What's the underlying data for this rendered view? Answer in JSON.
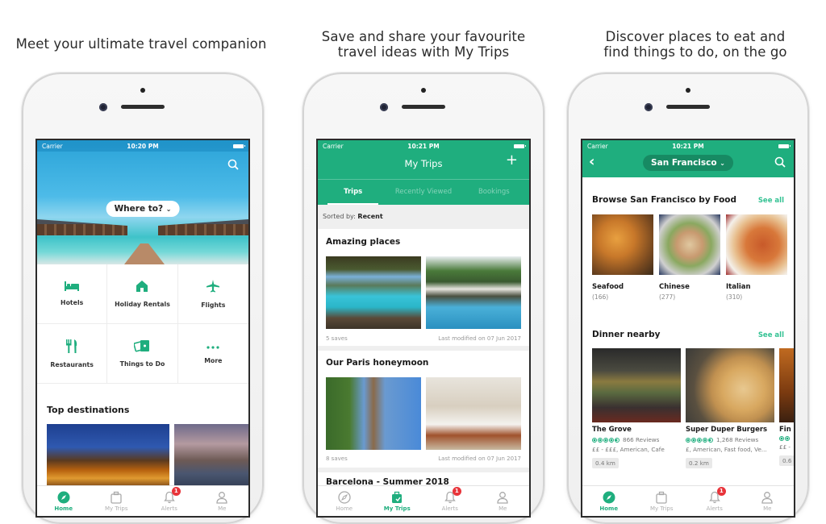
{
  "colors": {
    "accent": "#1fae7e",
    "accent_dark": "#178a63",
    "badge": "#e8343a",
    "hero_sky": "#2aa3d8"
  },
  "panels": [
    {
      "caption_lines": [
        "Meet your ultimate travel companion"
      ],
      "status": {
        "carrier": "Carrier",
        "time": "10:20 PM"
      },
      "search_icon": "search-icon",
      "where_to": "Where to?",
      "categories": [
        {
          "label": "Hotels",
          "icon": "bed-icon"
        },
        {
          "label": "Holiday Rentals",
          "icon": "house-icon"
        },
        {
          "label": "Flights",
          "icon": "plane-icon"
        },
        {
          "label": "Restaurants",
          "icon": "fork-knife-icon"
        },
        {
          "label": "Things to Do",
          "icon": "ticket-icon"
        },
        {
          "label": "More",
          "icon": "more-dots-icon"
        }
      ],
      "section_title": "Top destinations",
      "tabs": [
        {
          "label": "Home",
          "icon": "compass-icon",
          "active": true
        },
        {
          "label": "My Trips",
          "icon": "suitcase-icon",
          "active": false
        },
        {
          "label": "Alerts",
          "icon": "bell-icon",
          "active": false,
          "badge": "1"
        },
        {
          "label": "Me",
          "icon": "person-icon",
          "active": false
        }
      ]
    },
    {
      "caption_lines": [
        "Save and share your favourite",
        "travel ideas with My Trips"
      ],
      "status": {
        "carrier": "Carrier",
        "time": "10:21 PM"
      },
      "title": "My Trips",
      "add_label": "+",
      "subtabs": [
        {
          "label": "Trips",
          "active": true
        },
        {
          "label": "Recently Viewed",
          "active": false
        },
        {
          "label": "Bookings",
          "active": false
        }
      ],
      "sort_prefix": "Sorted by:",
      "sort_value": "Recent",
      "trips": [
        {
          "name": "Amazing places",
          "saves": "5 saves",
          "modified": "Last modified on 07 Jun 2017"
        },
        {
          "name": "Our Paris honeymoon",
          "saves": "8 saves",
          "modified": "Last modified on 07 Jun 2017"
        },
        {
          "name": "Barcelona - Summer 2018"
        }
      ],
      "tabs": [
        {
          "label": "Home",
          "icon": "compass-icon",
          "active": false
        },
        {
          "label": "My Trips",
          "icon": "suitcase-icon",
          "active": true
        },
        {
          "label": "Alerts",
          "icon": "bell-icon",
          "active": false,
          "badge": "1"
        },
        {
          "label": "Me",
          "icon": "person-icon",
          "active": false
        }
      ]
    },
    {
      "caption_lines": [
        "Discover places to eat and",
        "find things to do, on the go"
      ],
      "status": {
        "carrier": "Carrier",
        "time": "10:21 PM"
      },
      "city": "San Francisco",
      "food_section": {
        "title": "Browse San Francisco by Food",
        "see_all": "See all"
      },
      "foods": [
        {
          "name": "Seafood",
          "count": "(166)"
        },
        {
          "name": "Chinese",
          "count": "(277)"
        },
        {
          "name": "Italian",
          "count": "(310)"
        }
      ],
      "dinner_section": {
        "title": "Dinner nearby",
        "see_all": "See all"
      },
      "restaurants": [
        {
          "name": "The Grove",
          "reviews": "866 Reviews",
          "rating": 4.5,
          "tags": "££ - £££, American, Cafe",
          "distance": "0.4 km"
        },
        {
          "name": "Super Duper Burgers",
          "reviews": "1,268 Reviews",
          "rating": 4.5,
          "tags": "£, American, Fast food, Ve...",
          "distance": "0.2 km"
        },
        {
          "name": "Fin",
          "reviews": "",
          "rating": 4.5,
          "tags": "££ -",
          "distance": "0.6"
        }
      ],
      "tabs": [
        {
          "label": "Home",
          "icon": "compass-icon",
          "active": true
        },
        {
          "label": "My Trips",
          "icon": "suitcase-icon",
          "active": false
        },
        {
          "label": "Alerts",
          "icon": "bell-icon",
          "active": false,
          "badge": "1"
        },
        {
          "label": "Me",
          "icon": "person-icon",
          "active": false
        }
      ]
    }
  ]
}
